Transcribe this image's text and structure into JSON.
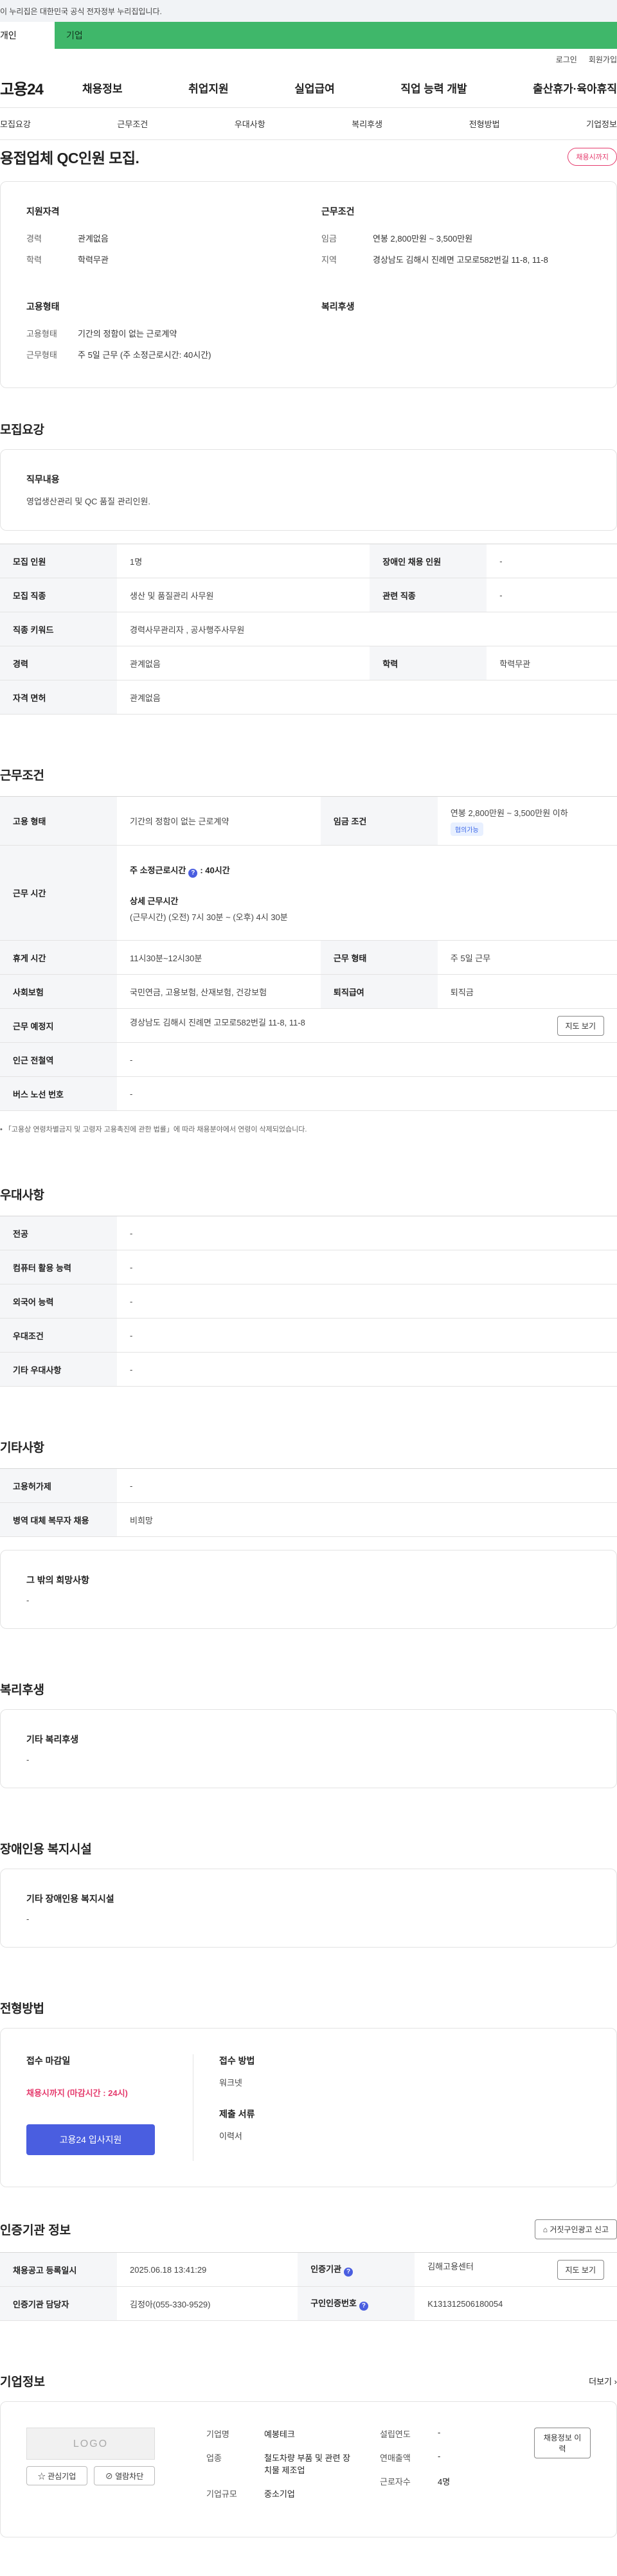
{
  "gov_banner": "이 누리집은 대한민국 공식 전자정부 누리집입니다.",
  "user_tabs": {
    "personal": "개인",
    "corporate": "기업"
  },
  "util": {
    "login": "로그인",
    "join": "회원가입"
  },
  "logo": "고용24",
  "gnb": [
    "채용정보",
    "취업지원",
    "실업급여",
    "직업 능력 개발",
    "출산휴가·육아휴직"
  ],
  "snb": [
    "모집요강",
    "근무조건",
    "우대사항",
    "복리후생",
    "전형방법",
    "기업정보"
  ],
  "job": {
    "title": "용접업체 QC인원 모집.",
    "status": "채용시까지"
  },
  "summary": {
    "qual_title": "지원자격",
    "qual": [
      {
        "k": "경력",
        "v": "관계없음"
      },
      {
        "k": "학력",
        "v": "학력무관"
      }
    ],
    "work_title": "근무조건",
    "work": [
      {
        "k": "임금",
        "v": "연봉 2,800만원 ~ 3,500만원"
      },
      {
        "k": "지역",
        "v": "경상남도 김해시 진례면 고모로582번길 11-8, 11-8"
      }
    ],
    "emp_title": "고용형태",
    "emp": [
      {
        "k": "고용형태",
        "v": "기간의 정함이 없는 근로계약"
      },
      {
        "k": "근무형태",
        "v": "주 5일 근무 (주 소정근로시간: 40시간)"
      }
    ],
    "welfare_title": "복리후생"
  },
  "recruit": {
    "title": "모집요강",
    "duty_title": "직무내용",
    "duty": "영업생산관리 및 QC 품질 관리인원.",
    "rows": [
      {
        "k1": "모집 인원",
        "v1": "1명",
        "k2": "장애인 채용 인원",
        "v2": "-"
      },
      {
        "k1": "모집 직종",
        "v1": "생산 및 품질관리 사무원",
        "k2": "관련 직종",
        "v2": "-"
      },
      {
        "k1": "직종 키워드",
        "v1": "경력사무관리자 , 공사행주사무원"
      },
      {
        "k1": "경력",
        "v1": "관계없음",
        "k2": "학력",
        "v2": "학력무관"
      },
      {
        "k1": "자격 면허",
        "v1": "관계없음"
      }
    ]
  },
  "conditions": {
    "title": "근무조건",
    "emp_type_label": "고용 형태",
    "emp_type": "기간의 정함이 없는 근로계약",
    "wage_label": "임금 조건",
    "wage": "연봉 2,800만원 ~ 3,500만원 이하",
    "wage_badge": "협의가능",
    "hours_label": "근무 시간",
    "hours_weekly_label": "주 소정근로시간",
    "hours_weekly": ": 40시간",
    "hours_detail_title": "상세 근무시간",
    "hours_detail": "(근무시간) (오전) 7시 30분 ~ (오후) 4시 30분",
    "rows": [
      {
        "k1": "휴게 시간",
        "v1": "11시30분~12시30분",
        "k2": "근무 형태",
        "v2": "주 5일 근무"
      },
      {
        "k1": "사회보험",
        "v1": "국민연금, 고용보험, 산재보험, 건강보험",
        "k2": "퇴직급여",
        "v2": "퇴직금"
      }
    ],
    "location_label": "근무 예정지",
    "location": "경상남도 김해시 진례면 고모로582번길 11-8, 11-8",
    "map_btn": "지도 보기",
    "subway_label": "인근 전철역",
    "subway": "-",
    "bus_label": "버스 노선 번호",
    "bus": "-",
    "note": "「고용상 연령차별금지 및 고령자 고용촉진에 관한 법률」에 따라 채용분야에서 연령이 삭제되었습니다."
  },
  "preferences": {
    "title": "우대사항",
    "rows": [
      {
        "k": "전공",
        "v": "-"
      },
      {
        "k": "컴퓨터 활용 능력",
        "v": "-"
      },
      {
        "k": "외국어 능력",
        "v": "-"
      },
      {
        "k": "우대조건",
        "v": "-"
      },
      {
        "k": "기타 우대사항",
        "v": "-"
      }
    ]
  },
  "other": {
    "title": "기타사항",
    "rows": [
      {
        "k": "고용허가제",
        "v": "-"
      },
      {
        "k": "병역 대체 복무자 채용",
        "v": "비희망"
      }
    ],
    "wish_title": "그 밖의 희망사항",
    "wish": "-"
  },
  "welfare": {
    "title": "복리후생",
    "box_title": "기타 복리후생",
    "box_value": "-"
  },
  "disabled": {
    "title": "장애인용 복지시설",
    "box_title": "기타 장애인용 복지시설",
    "box_value": "-"
  },
  "selection": {
    "title": "전형방법",
    "deadline_title": "접수 마감일",
    "deadline": "채용시까지 (마감시간 : 24시)",
    "apply_btn": "고용24 입사지원",
    "method_title": "접수 방법",
    "method": "워크넷",
    "docs_title": "제출 서류",
    "docs": "이력서"
  },
  "cert": {
    "title": "인증기관 정보",
    "report_btn": "거짓구인광고 신고",
    "reg_label": "채용공고 등록일시",
    "reg": "2025.06.18 13:41:29",
    "org_label": "인증기관",
    "org": "김해고용센터",
    "map_btn": "지도 보기",
    "manager_label": "인증기관 담당자",
    "manager": "김정아(055-330-9529)",
    "no_label": "구인인증번호",
    "no": "K131312506180054"
  },
  "company": {
    "title": "기업정보",
    "more": "더보기",
    "logo": "LOGO",
    "fav_btn": "관심기업",
    "block_btn": "열람차단",
    "rows_left": [
      {
        "k": "기업명",
        "v": "예봉테크"
      },
      {
        "k": "업종",
        "v": "철도차량 부품 및 관련 장치물 제조업"
      },
      {
        "k": "기업규모",
        "v": "중소기업"
      }
    ],
    "rows_right": [
      {
        "k": "설립연도",
        "v": "-"
      },
      {
        "k": "연매출액",
        "v": "-"
      },
      {
        "k": "근로자수",
        "v": "4명"
      }
    ],
    "history_btn": "채용정보 이력"
  }
}
